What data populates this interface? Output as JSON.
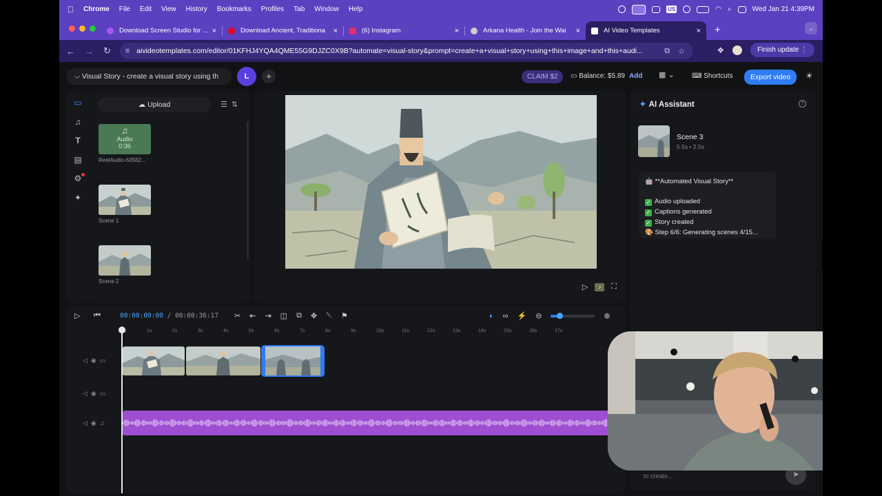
{
  "menubar": {
    "app": "Chrome",
    "items": [
      "File",
      "Edit",
      "View",
      "History",
      "Bookmarks",
      "Profiles",
      "Tab",
      "Window",
      "Help"
    ],
    "input_badge": "US",
    "datetime": "Wed Jan 21  4:39PM"
  },
  "tabs": [
    {
      "title": "Download Screen Studio for …",
      "favicon_color": "#a855f7"
    },
    {
      "title": "Download Ancient, Traditiona",
      "favicon_color": "#e60023"
    },
    {
      "title": "(6) Instagram",
      "favicon_color": "#e1306c"
    },
    {
      "title": "Arkana Health - Join the Wai",
      "favicon_color": "#cccccc"
    },
    {
      "title": "AI Video Templates",
      "favicon_color": "#ffffff",
      "active": true
    }
  ],
  "address": {
    "url": "aivideotemplates.com/editor/01KFHJ4YQA4QME55G9DJZC0X9B?automate=visual-story&prompt=create+a+visual+story+using+this+image+and+this+audi...",
    "finish_update": "Finish update"
  },
  "header": {
    "project_title": "Visual Story - create a visual story using th",
    "avatar_initial": "L",
    "claim": "CLAIM $2",
    "balance": "Balance: $5.89",
    "balance_add": "Add",
    "shortcuts": "Shortcuts",
    "export": "Export video"
  },
  "media": {
    "upload": "Upload",
    "audio_tile_label": "Audio",
    "audio_tile_duration": "0:36",
    "audio_caption": "ReelAudio-63582...",
    "scenes": [
      {
        "caption": "Scene 1"
      },
      {
        "caption": "Scene 2"
      }
    ]
  },
  "timeline": {
    "current_time": "00:00:00:00",
    "separator": "/",
    "total_time": "00:00:36:17",
    "ruler": [
      "0s",
      "1s",
      "2s",
      "3s",
      "4s",
      "5s",
      "6s",
      "7s",
      "8s",
      "9s",
      "10s",
      "11s",
      "12s",
      "13s",
      "14s",
      "15s",
      "16s",
      "17s"
    ],
    "zoom_level": 0.2
  },
  "assistant": {
    "title": "AI Assistant",
    "scene_title": "Scene 3",
    "scene_meta": "5.5s • 2.5s",
    "message_head": "🤖 **Automated Visual Story**",
    "steps": [
      "Audio uploaded",
      "Captions generated",
      "Story created"
    ],
    "progress_line": "🎨 Step 6/6: Generating scenes 4/15...",
    "input_placeholder": "to create..."
  },
  "colors": {
    "accent": "#2f7cf6",
    "menubar": "#5b40c0",
    "audio_track": "#9d4ed1",
    "audio_tile": "#4a7a54"
  }
}
